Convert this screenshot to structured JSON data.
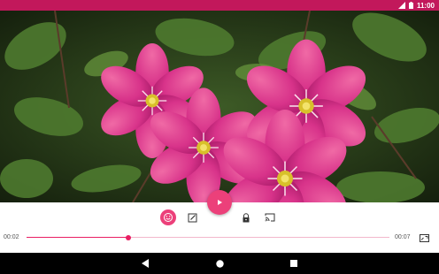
{
  "status_bar": {
    "time": "11:00",
    "icons": [
      "signal-icon",
      "battery-icon"
    ],
    "color": "#c2185b"
  },
  "video": {
    "content": "pink-clematis-flowers-video-frame"
  },
  "player": {
    "current_time": "00:02",
    "total_time": "00:07",
    "progress_fraction": 0.28,
    "accent_color": "#e91e63",
    "buttons": [
      "emoji-icon",
      "edit-icon",
      "play-icon",
      "lock-icon",
      "cast-icon",
      "fullscreen-icon"
    ]
  },
  "nav_bar": {
    "buttons": [
      "back-icon",
      "home-icon",
      "recents-icon"
    ]
  }
}
